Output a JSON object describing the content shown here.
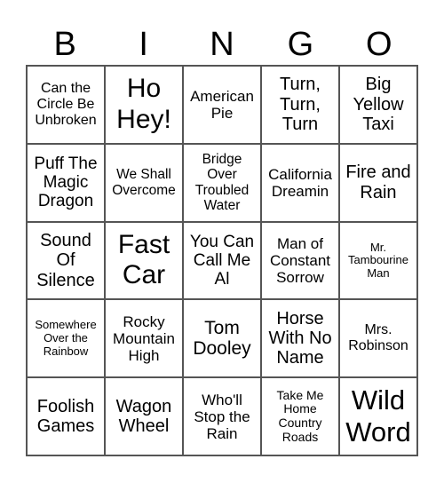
{
  "header": {
    "letters": [
      "B",
      "I",
      "N",
      "G",
      "O"
    ]
  },
  "cells": [
    [
      "Can the Circle Be Unbroken",
      "Ho Hey!",
      "American Pie",
      "Turn, Turn, Turn",
      "Big Yellow Taxi"
    ],
    [
      "Puff The Magic Dragon",
      "We Shall Overcome",
      "Bridge Over Troubled Water",
      "California Dreamin",
      "Fire and Rain"
    ],
    [
      "Sound Of Silence",
      "Fast Car",
      "You Can Call Me Al",
      "Man of Constant Sorrow",
      "Mr. Tambourine Man"
    ],
    [
      "Somewhere Over the Rainbow",
      "Rocky Mountain High",
      "Tom Dooley",
      "Horse With No Name",
      "Mrs. Robinson"
    ],
    [
      "Foolish Games",
      "Wagon Wheel",
      "Who'll Stop the Rain",
      "Take Me Home Country Roads",
      "Wild Word"
    ]
  ]
}
